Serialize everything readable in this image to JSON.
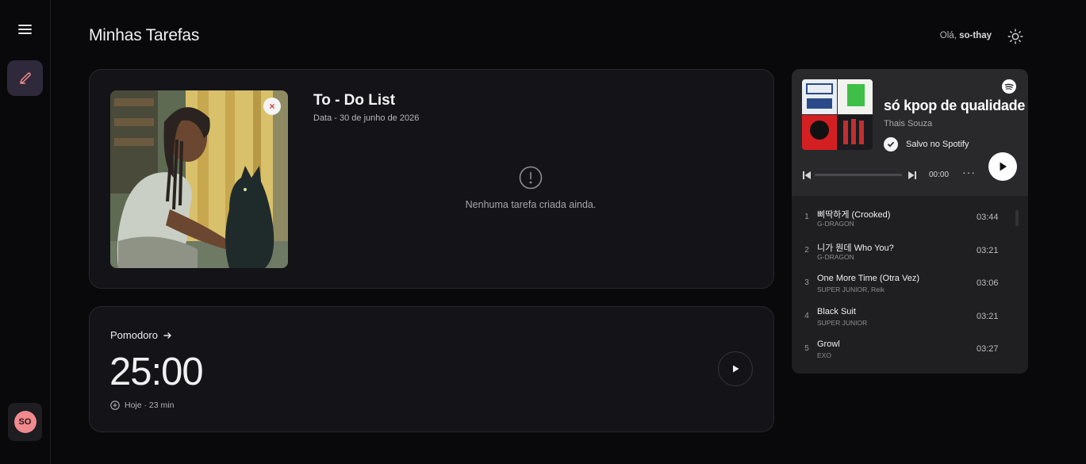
{
  "header": {
    "title": "Minhas Tarefas",
    "greeting_prefix": "Olá, ",
    "username": "so-thay"
  },
  "sidebar": {
    "avatar_initials": "SO"
  },
  "todo": {
    "title": "To - Do List",
    "date": "Data - 30 de junho de 2026",
    "empty_message": "Nenhuma tarefa criada ainda.",
    "remove_symbol": "×"
  },
  "pomodoro": {
    "label": "Pomodoro",
    "time": "25:00",
    "meta": "Hoje · 23 min"
  },
  "spotify": {
    "playlist_title": "só kpop de qualidade",
    "owner": "Thais Souza",
    "saved_label": "Salvo no Spotify",
    "current_time": "00:00",
    "progress": 0,
    "more": "···",
    "tracks": [
      {
        "num": "1",
        "name": "삐딱하게 (Crooked)",
        "artist": "G-DRAGON",
        "duration": "03:44"
      },
      {
        "num": "2",
        "name": "니가 뭔데 Who You?",
        "artist": "G-DRAGON",
        "duration": "03:21"
      },
      {
        "num": "3",
        "name": "One More Time (Otra Vez)",
        "artist": "SUPER JUNIOR, Reik",
        "duration": "03:06"
      },
      {
        "num": "4",
        "name": "Black Suit",
        "artist": "SUPER JUNIOR",
        "duration": "03:21"
      },
      {
        "num": "5",
        "name": "Growl",
        "artist": "EXO",
        "duration": "03:27"
      }
    ]
  },
  "colors": {
    "background": "#09090b",
    "card": "#141317",
    "accent_nav": "#2e2a3b",
    "avatar": "#f08a8e",
    "spotify_panel": "#1f1f22"
  }
}
